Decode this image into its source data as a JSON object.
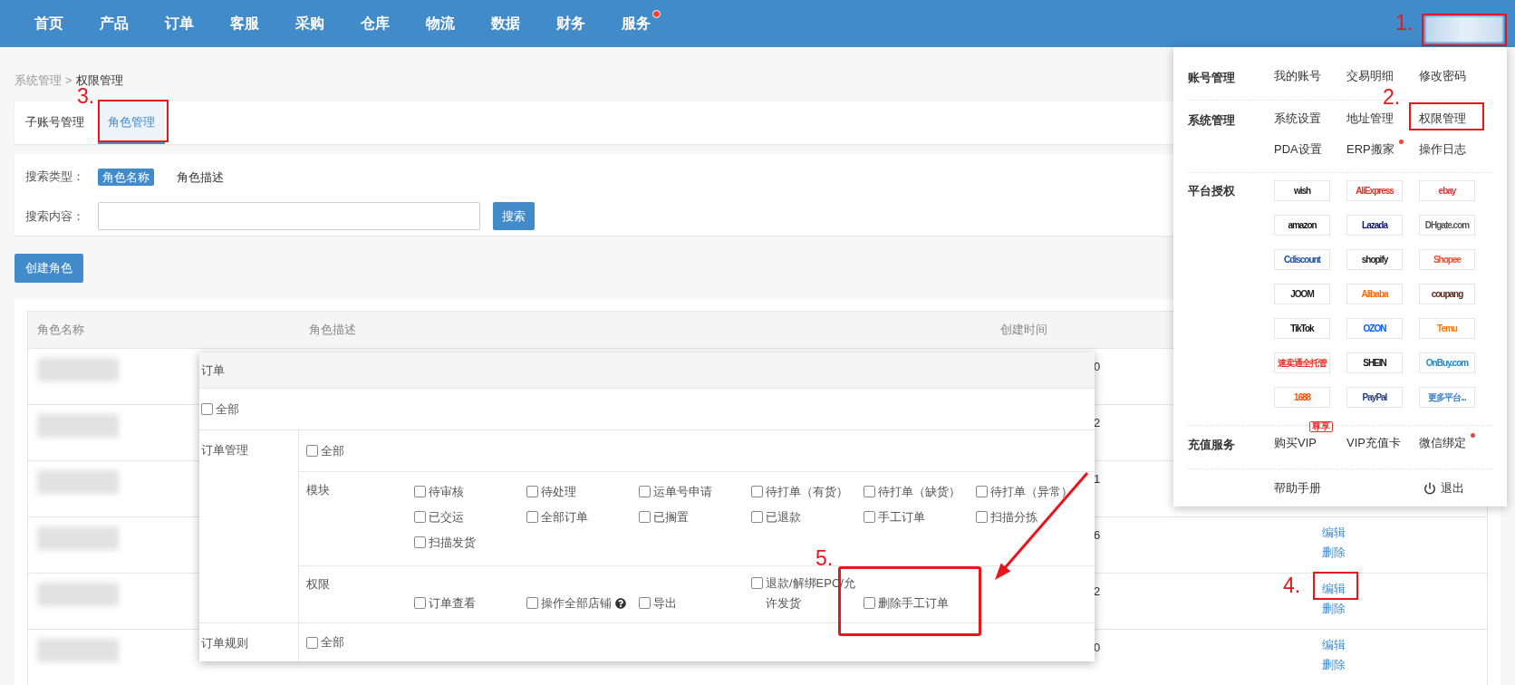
{
  "nav": {
    "items": [
      {
        "label": "首页",
        "dot": false
      },
      {
        "label": "产品",
        "dot": false
      },
      {
        "label": "订单",
        "dot": false
      },
      {
        "label": "客服",
        "dot": false
      },
      {
        "label": "采购",
        "dot": false
      },
      {
        "label": "仓库",
        "dot": false
      },
      {
        "label": "物流",
        "dot": false
      },
      {
        "label": "数据",
        "dot": false
      },
      {
        "label": "财务",
        "dot": false
      },
      {
        "label": "服务",
        "dot": true
      }
    ]
  },
  "breadcrumb": {
    "items": [
      "系统管理",
      "权限管理"
    ],
    "separator": ">"
  },
  "tabs": [
    {
      "label": "子账号管理",
      "selected": false
    },
    {
      "label": "角色管理",
      "selected": true
    }
  ],
  "search": {
    "type_label": "搜索类型：",
    "types": [
      {
        "label": "角色名称",
        "selected": true
      },
      {
        "label": "角色描述",
        "selected": false
      }
    ],
    "content_label": "搜索内容：",
    "button": "搜索"
  },
  "create_button": "创建角色",
  "table": {
    "columns": [
      "角色名称",
      "角色描述",
      "创建时间"
    ],
    "rows": [
      {
        "created": "0"
      },
      {
        "created": "2"
      },
      {
        "created": "1"
      },
      {
        "created": "6",
        "actions": [
          "编辑",
          "删除"
        ]
      },
      {
        "created": "2",
        "actions": [
          "编辑",
          "删除"
        ]
      },
      {
        "created": "0",
        "actions": [
          "编辑",
          "删除"
        ]
      }
    ]
  },
  "permission_dialog": {
    "title": "订单",
    "all": {
      "label": "全部",
      "checked": false
    },
    "groups": [
      {
        "name": "订单管理",
        "all": {
          "label": "全部",
          "checked": false
        },
        "sections": [
          {
            "name": "模块",
            "options": [
              {
                "label": "待审核",
                "checked": false
              },
              {
                "label": "待处理",
                "checked": false
              },
              {
                "label": "运单号申请",
                "checked": false
              },
              {
                "label": "待打单（有货）",
                "checked": false
              },
              {
                "label": "待打单（缺货）",
                "checked": false
              },
              {
                "label": "待打单（异常）",
                "checked": false
              },
              {
                "label": "已交运",
                "checked": false
              },
              {
                "label": "全部订单",
                "checked": false
              },
              {
                "label": "已搁置",
                "checked": false
              },
              {
                "label": "已退款",
                "checked": false
              },
              {
                "label": "手工订单",
                "checked": false
              },
              {
                "label": "扫描分拣",
                "checked": false
              },
              {
                "label": "扫描发货",
                "checked": false
              }
            ]
          },
          {
            "name": "权限",
            "options": [
              {
                "label": "订单查看",
                "checked": false,
                "help": false
              },
              {
                "label": "操作全部店铺",
                "checked": false,
                "help": true
              },
              {
                "label": "导出",
                "checked": false,
                "help": false
              },
              {
                "label": "退款/解绑EPC/允许发货",
                "checked": false,
                "help": false
              },
              {
                "label": "删除手工订单",
                "checked": false,
                "help": false
              }
            ]
          }
        ]
      },
      {
        "name": "订单规则",
        "all": {
          "label": "全部",
          "checked": false
        }
      }
    ]
  },
  "menu": {
    "sections": [
      {
        "title": "账号管理",
        "kind": "links",
        "items": [
          {
            "label": "我的账号",
            "dot": false
          },
          {
            "label": "交易明细",
            "dot": false
          },
          {
            "label": "修改密码",
            "dot": false
          }
        ]
      },
      {
        "title": "系统管理",
        "kind": "links",
        "items": [
          {
            "label": "系统设置",
            "dot": false
          },
          {
            "label": "地址管理",
            "dot": false
          },
          {
            "label": "权限管理",
            "dot": false
          },
          {
            "label": "PDA设置",
            "dot": false
          },
          {
            "label": "ERP搬家",
            "dot": true
          },
          {
            "label": "操作日志",
            "dot": false
          }
        ]
      },
      {
        "title": "平台授权",
        "kind": "logos",
        "items": [
          {
            "label": "wish",
            "color": "#222222"
          },
          {
            "label": "AliExpress",
            "color": "#e43225"
          },
          {
            "label": "ebay",
            "color": "#e53238"
          },
          {
            "label": "amazon",
            "color": "#111111"
          },
          {
            "label": "Lazada",
            "color": "#0f146d"
          },
          {
            "label": "DHgate.com",
            "color": "#555555"
          },
          {
            "label": "Cdiscount",
            "color": "#1f4fa0"
          },
          {
            "label": "shopify",
            "color": "#222222"
          },
          {
            "label": "Shopee",
            "color": "#ee4d2d"
          },
          {
            "label": "JOOM",
            "color": "#222222"
          },
          {
            "label": "Alibaba",
            "color": "#ff6a00"
          },
          {
            "label": "coupang",
            "color": "#5b2a1e"
          },
          {
            "label": "TikTok",
            "color": "#111111"
          },
          {
            "label": "OZON",
            "color": "#005bff"
          },
          {
            "label": "Temu",
            "color": "#fb7701"
          },
          {
            "label": "速卖通全托管",
            "color": "#e43225"
          },
          {
            "label": "SHEIN",
            "color": "#111111"
          },
          {
            "label": "OnBuy.com",
            "color": "#1a8acb"
          },
          {
            "label": "1688",
            "color": "#ff5000"
          },
          {
            "label": "PayPal",
            "color": "#253b80"
          },
          {
            "label": "更多平台...",
            "color": "#3f7fc4"
          }
        ]
      },
      {
        "title": "充值服务",
        "kind": "links",
        "items": [
          {
            "label": "购买VIP",
            "dot": false,
            "badge": "尊享"
          },
          {
            "label": "VIP充值卡",
            "dot": false
          },
          {
            "label": "微信绑定",
            "dot": true
          }
        ]
      },
      {
        "kind": "footer",
        "items": [
          {
            "label": "帮助手册",
            "kind": "link"
          },
          {
            "label": "退出",
            "kind": "logout"
          }
        ]
      }
    ]
  },
  "annotations": [
    "1.",
    "2.",
    "3.",
    "4.",
    "5."
  ]
}
